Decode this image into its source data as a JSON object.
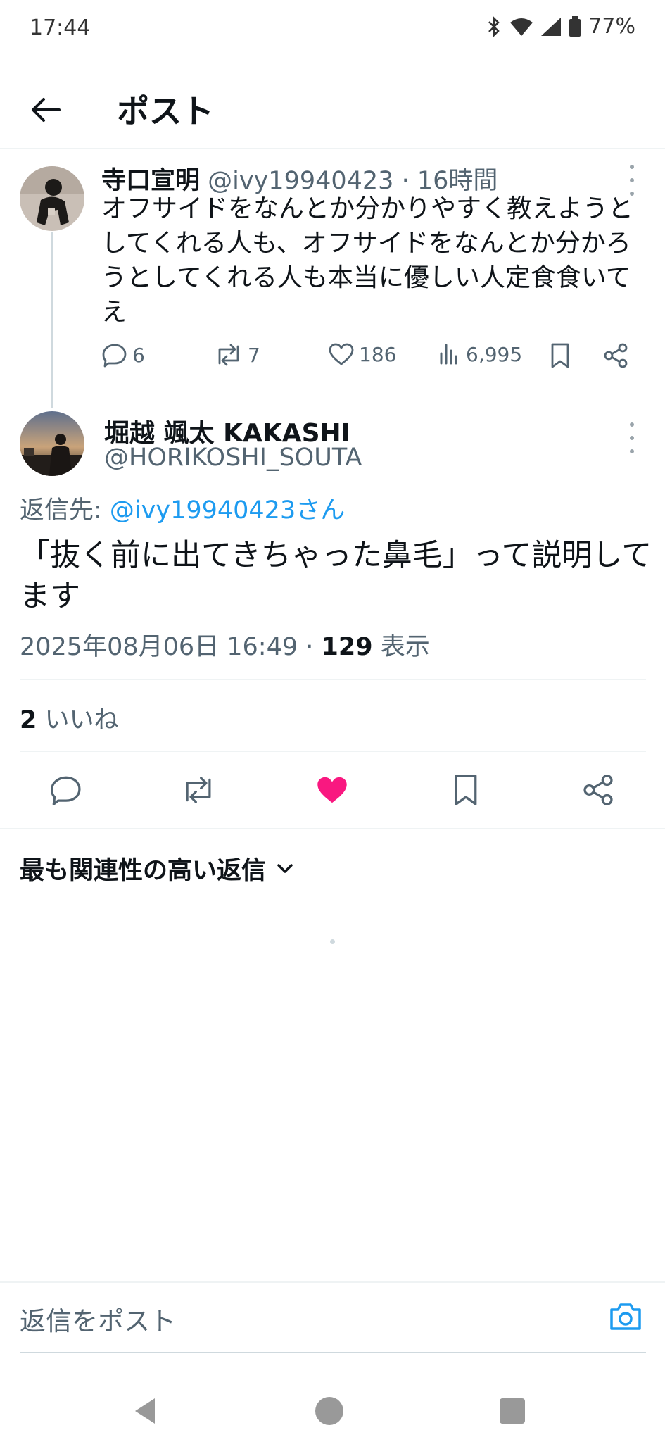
{
  "status_bar": {
    "time": "17:44",
    "battery": "77%"
  },
  "header": {
    "title": "ポスト"
  },
  "post1": {
    "name": "寺口宣明",
    "handle": "@ivy19940423",
    "time": "16時間",
    "text": "オフサイドをなんとか分かりやすく教えようとしてくれる人も、オフサイドをなんとか分かろうとしてくれる人も本当に優しい人定食食いてえ",
    "replies": "6",
    "reposts": "7",
    "likes": "186",
    "views": "6,995"
  },
  "post2": {
    "name": "堀越 颯太 KAKASHI",
    "handle": "@HORIKOSHI_SOUTA",
    "reply_prefix": "返信先: ",
    "reply_to": "@ivy19940423さん",
    "text": "「抜く前に出てきちゃった鼻毛」って説明してます",
    "datetime": "2025年08月06日 16:49 · ",
    "views_count": "129",
    "views_label": " 表示",
    "likes_count": "2",
    "likes_label": " いいね"
  },
  "sort": {
    "label": "最も関連性の高い返信"
  },
  "composer": {
    "placeholder": "返信をポスト"
  },
  "colors": {
    "like_active": "#f91880",
    "link": "#1d9bf0",
    "secondary_text": "#536471"
  }
}
